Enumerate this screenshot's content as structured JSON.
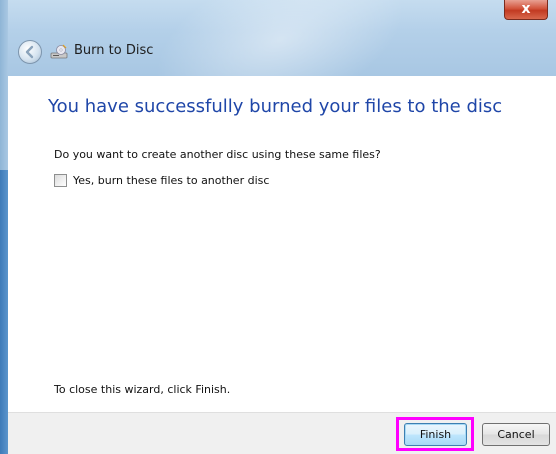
{
  "window": {
    "title": "Burn to Disc",
    "close_glyph": "x"
  },
  "icons": {
    "back": "back-arrow-icon",
    "app": "burn-disc-icon",
    "checkbox": "checkbox-unchecked"
  },
  "content": {
    "heading": "You have successfully burned your files to the disc",
    "question": "Do you want to create another disc using these same files?",
    "checkbox_label": "Yes, burn these files to another disc",
    "checkbox_checked": false,
    "close_hint": "To close this wizard, click Finish."
  },
  "footer": {
    "finish_label": "Finish",
    "cancel_label": "Cancel"
  },
  "colors": {
    "heading": "#1f46a8",
    "highlight": "#ff00ff",
    "close_button": "#c23a22"
  }
}
